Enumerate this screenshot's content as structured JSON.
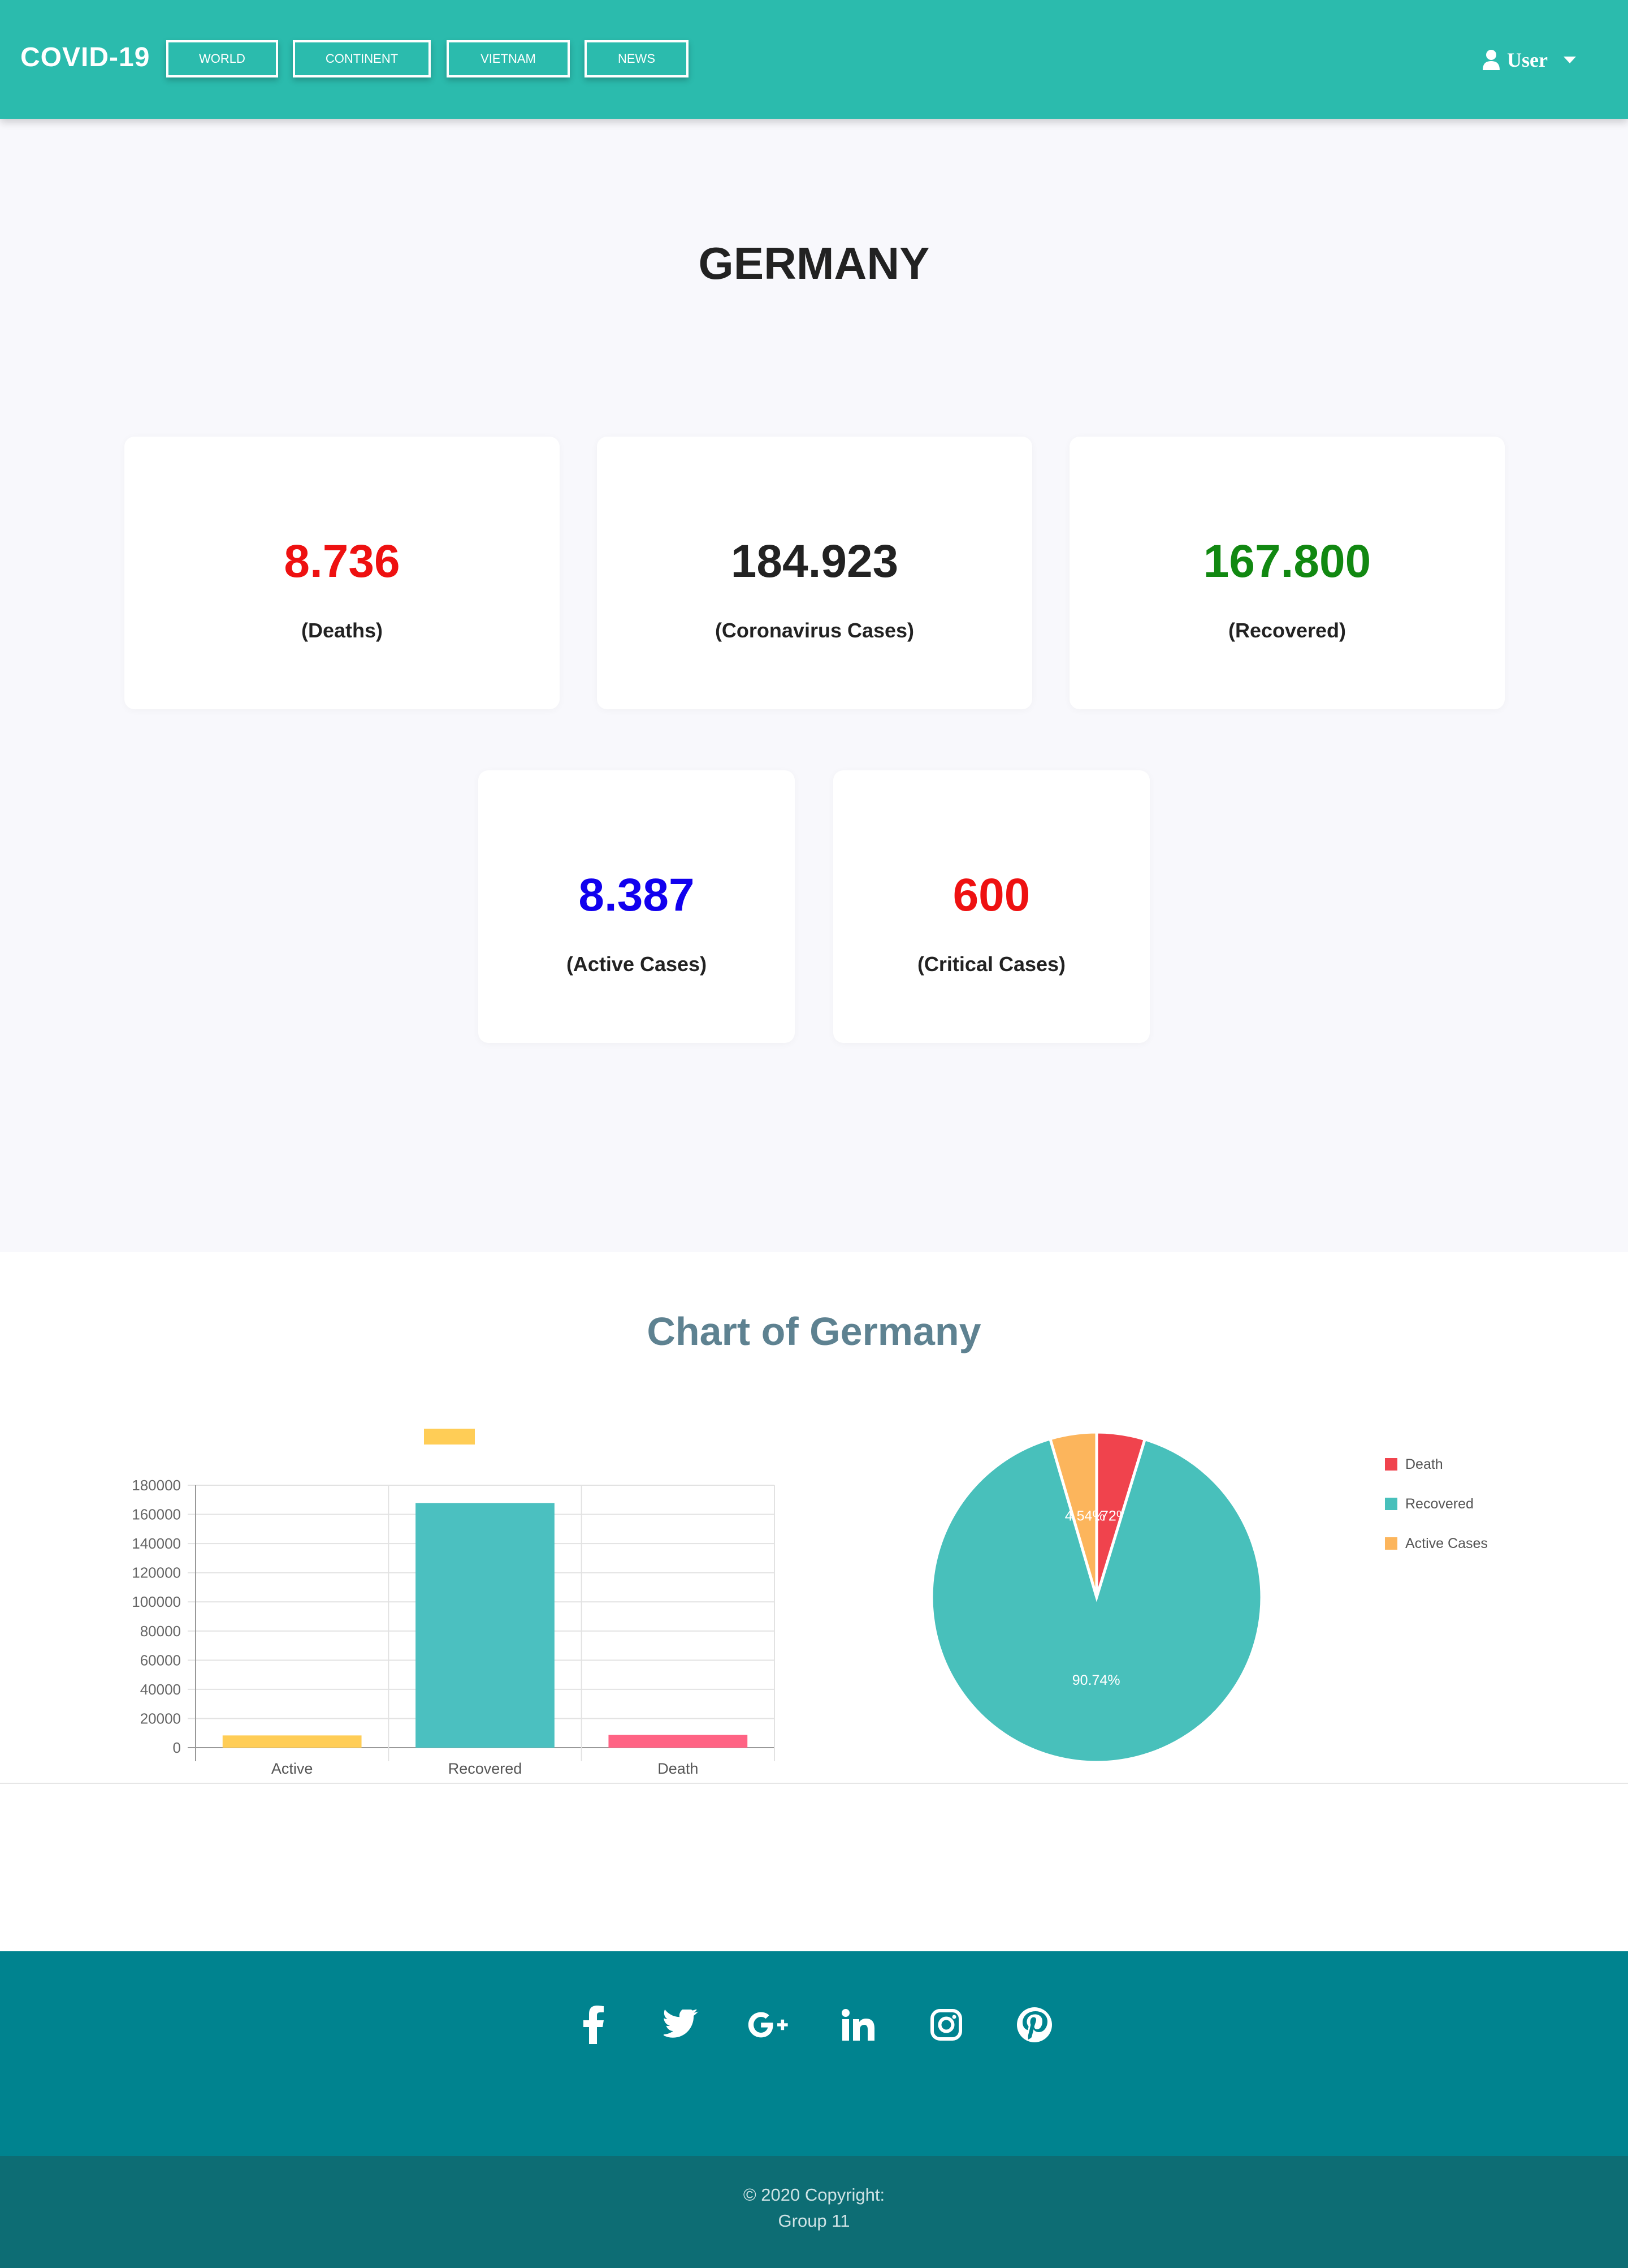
{
  "navbar": {
    "brand": "COVID-19",
    "links": [
      {
        "label": "WORLD"
      },
      {
        "label": "CONTINENT"
      },
      {
        "label": "VIETNAM"
      },
      {
        "label": "NEWS"
      }
    ],
    "user_label": "User",
    "background_color": "#2bbbad"
  },
  "country": {
    "name": "GERMANY",
    "stats": {
      "deaths": {
        "value": "8.736",
        "label": "(Deaths)",
        "color": "#ee1111"
      },
      "cases": {
        "value": "184.923",
        "label": "(Coronavirus Cases)",
        "color": "#222222"
      },
      "recovered": {
        "value": "167.800",
        "label": "(Recovered)",
        "color": "#118811"
      },
      "active": {
        "value": "8.387",
        "label": "(Active Cases)",
        "color": "#1100ee"
      },
      "critical": {
        "value": "600",
        "label": "(Critical Cases)",
        "color": "#ee1111"
      }
    }
  },
  "chart_section": {
    "title": "Chart of Germany"
  },
  "chart_data": [
    {
      "type": "bar",
      "categories": [
        "Active",
        "Recovered",
        "Death"
      ],
      "values": [
        8387,
        167800,
        8736
      ],
      "colors": [
        "#ffcd56",
        "#4bc0c0",
        "#ff6384"
      ],
      "ylim": [
        0,
        180000
      ],
      "yticks": [
        0,
        20000,
        40000,
        60000,
        80000,
        100000,
        120000,
        140000,
        160000,
        180000
      ],
      "grid": true,
      "legend": {
        "swatch_color": "#ffcd56",
        "placement": "top"
      }
    },
    {
      "type": "pie",
      "labels": [
        "Death",
        "Recovered",
        "Active Cases"
      ],
      "values": [
        4.72,
        90.74,
        4.54
      ],
      "data_labels": [
        "4.72%",
        "90.74%",
        "4.54%"
      ],
      "colors": [
        "#f0434d",
        "#48c0bb",
        "#fcb55c"
      ],
      "legend": "right"
    }
  ],
  "footer": {
    "social_icons": [
      "facebook-icon",
      "twitter-icon",
      "google-plus-icon",
      "linkedin-icon",
      "instagram-icon",
      "pinterest-icon"
    ],
    "copyright_line1": "© 2020 Copyright:",
    "copyright_line2": "Group 11"
  }
}
